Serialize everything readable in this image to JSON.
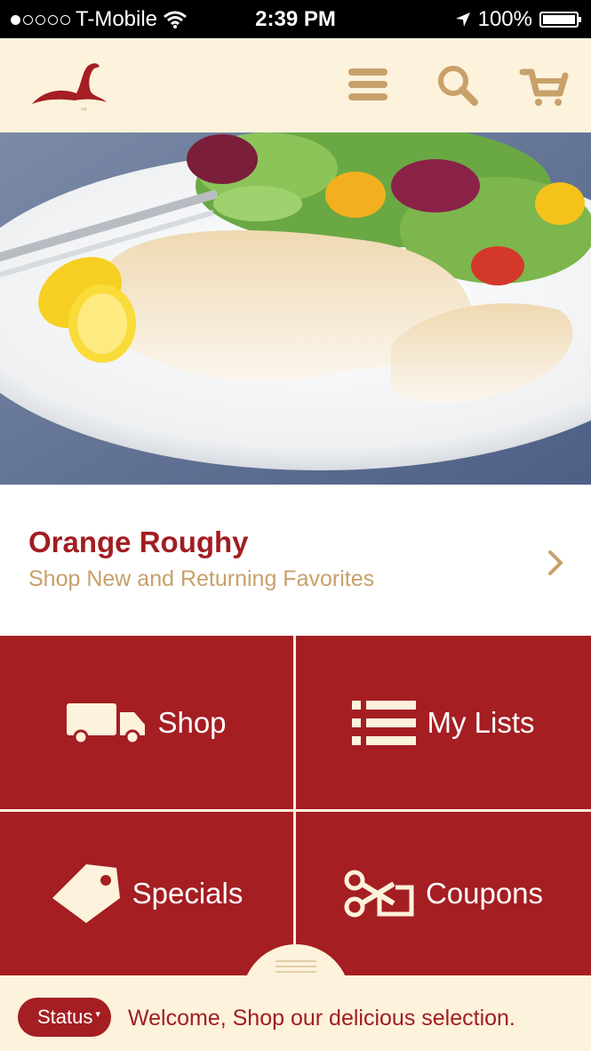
{
  "status_bar": {
    "carrier": "T-Mobile",
    "time": "2:39 PM",
    "battery": "100%"
  },
  "header": {
    "logo_mark": "™",
    "icons": [
      "menu-icon",
      "search-icon",
      "cart-icon"
    ]
  },
  "hero": {
    "image": "fish-fillet-plate-photo"
  },
  "promo": {
    "title": "Orange Roughy",
    "subtitle": "Shop New and Returning Favorites"
  },
  "tiles": {
    "shop": "Shop",
    "lists": "My Lists",
    "specials": "Specials",
    "coupons": "Coupons"
  },
  "footer": {
    "status_label": "Status",
    "status_caret": "▾",
    "message": "Welcome, Shop our delicious selection."
  },
  "colors": {
    "brand_red": "#a41e22",
    "cream": "#fdf2dc",
    "tan": "#c8a06a"
  }
}
